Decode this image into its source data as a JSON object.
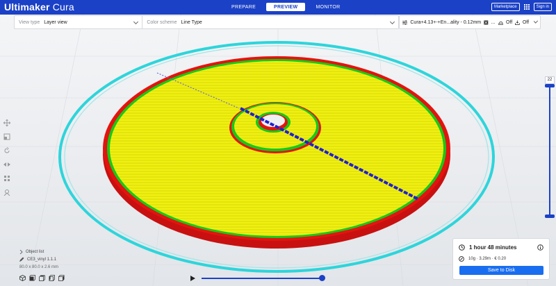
{
  "app": {
    "brand": "Ultimaker",
    "product": "Cura"
  },
  "stages": [
    {
      "label": "PREPARE",
      "active": false
    },
    {
      "label": "PREVIEW",
      "active": true
    },
    {
      "label": "MONITOR",
      "active": false
    }
  ],
  "top_right": {
    "marketplace": "Marketplace",
    "sign_in": "Sign in"
  },
  "header": {
    "view_type_label": "View type",
    "view_type_value": "Layer view",
    "color_scheme_label": "Color scheme",
    "color_scheme_value": "Line Type",
    "profile": "Cura+4.13+-+En...ality - 0.12mm",
    "support_value": "...",
    "adhesion_value": "Off",
    "infill_value": "Off"
  },
  "layer_slider": {
    "current_layer": "22"
  },
  "object_list": {
    "title": "Object list",
    "object_name": "CE3_vinyl 1.1.1",
    "dimensions": "80.0 x 80.0 x 2.6 mm"
  },
  "print_info": {
    "time": "1 hour 48 minutes",
    "material": "10g · 3.29m · € 0.20",
    "save_button": "Save to Disk"
  },
  "colors": {
    "brand_blue": "#1b41c6",
    "button_blue": "#196ef0",
    "wall_red": "#e3140f",
    "infill_yellow": "#f0f010",
    "inner_wall_green": "#18c818",
    "skirt_cyan": "#2dd5db",
    "travel_blue": "#2020d0"
  },
  "icons": {
    "move": "move-icon",
    "scale": "scale-icon",
    "rotate": "rotate-icon",
    "mirror": "mirror-icon",
    "per_model": "per-model-settings-icon",
    "support_blocker": "support-blocker-icon",
    "clock": "clock-icon",
    "material": "spool-icon",
    "info": "info-icon"
  }
}
